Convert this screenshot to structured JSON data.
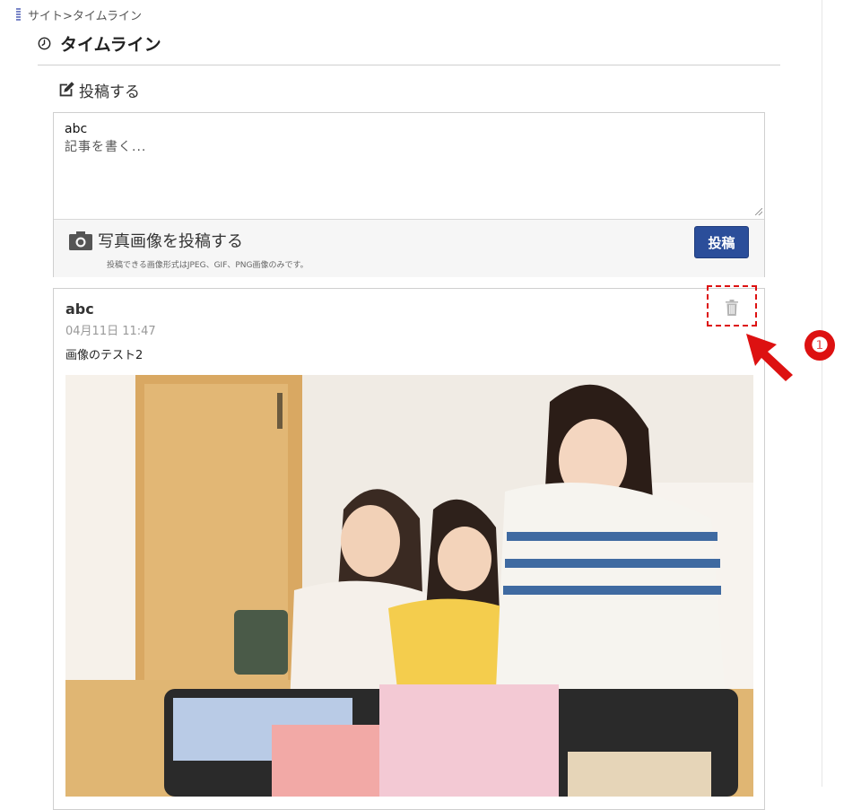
{
  "breadcrumb": {
    "text": "サイト>タイムライン"
  },
  "page": {
    "title": "タイムライン"
  },
  "compose": {
    "heading": "投稿する",
    "value": "abc",
    "placeholder": "記事を書く...",
    "photo_label": "写真画像を投稿する",
    "photo_note": "投稿できる画像形式はJPEG、GIF、PNG画像のみです。",
    "submit_label": "投稿"
  },
  "post": {
    "author": "abc",
    "timestamp": "04月11日 11:47",
    "body": "画像のテスト2",
    "photo_alt": "family-packing-suitcase-photo"
  },
  "annotation": {
    "number": "❶"
  },
  "colors": {
    "accent": "#2b4e9a",
    "annotation": "#dd1111"
  },
  "icons": [
    "clock-icon",
    "edit-icon",
    "camera-icon",
    "trash-icon",
    "callout-arrow-icon"
  ]
}
